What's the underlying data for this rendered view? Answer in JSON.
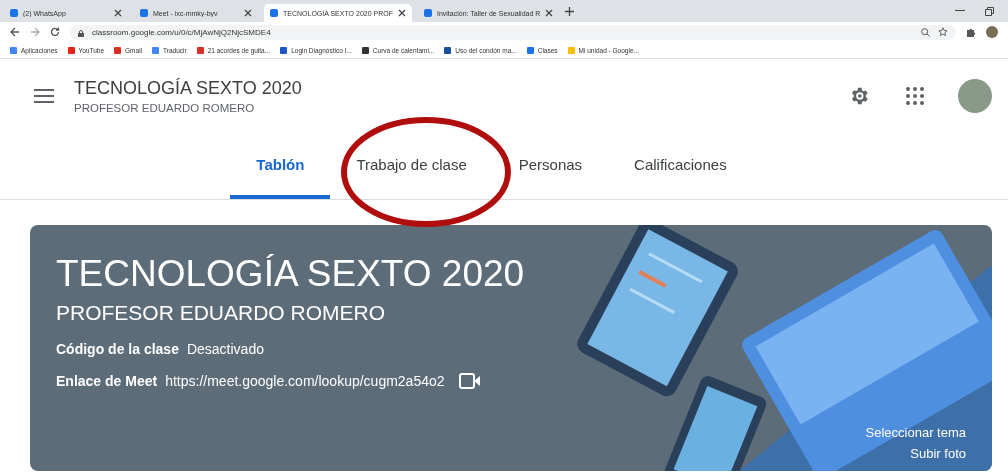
{
  "browser": {
    "tabs": [
      {
        "title": "(2) WhatsApp",
        "selected": false
      },
      {
        "title": "Meet - ixc-mmky-byv",
        "selected": false
      },
      {
        "title": "TECNOLOGÍA SEXTO 2020 PROF",
        "selected": true
      },
      {
        "title": "Invitación: Taller de Sexualidad R",
        "selected": false
      }
    ],
    "url": "classroom.google.com/u/0/c/MjAwNjQ2NjcSMDE4",
    "bookmarks": [
      "Aplicaciones",
      "YouTube",
      "Gmail",
      "Traducir",
      "21 acordes de guita...",
      "Login Diagnóstico I...",
      "Curva de calentami...",
      "Uso del condón ma...",
      "Clases",
      "Mi unidad - Google..."
    ]
  },
  "header": {
    "title": "TECNOLOGÍA SEXTO 2020",
    "subtitle": "PROFESOR EDUARDO ROMERO"
  },
  "tabs": [
    {
      "label": "Tablón",
      "selected": true
    },
    {
      "label": "Trabajo de clase",
      "selected": false
    },
    {
      "label": "Personas",
      "selected": false
    },
    {
      "label": "Calificaciones",
      "selected": false
    }
  ],
  "banner": {
    "title": "TECNOLOGÍA SEXTO 2020",
    "subtitle": "PROFESOR EDUARDO ROMERO",
    "code_label": "Código de la clase",
    "code_value": "Desactivado",
    "meet_label": "Enlace de Meet",
    "meet_link": "https://meet.google.com/lookup/cugm2a54o2",
    "actions": [
      "Seleccionar tema",
      "Subir foto"
    ]
  }
}
